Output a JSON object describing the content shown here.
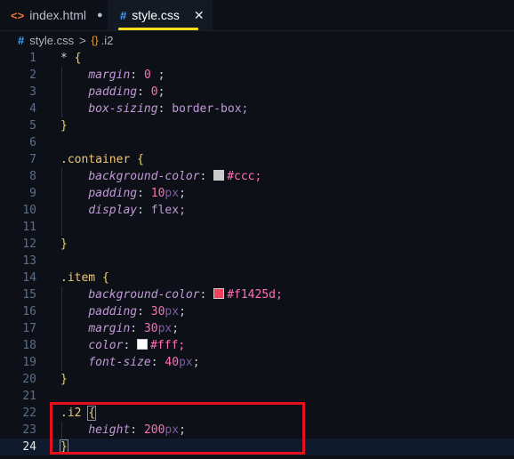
{
  "tabs": [
    {
      "label": "index.html",
      "icon": "html-icon",
      "icon_glyph": "<>",
      "modified_dot": "●"
    },
    {
      "label": "style.css",
      "icon": "css-icon",
      "icon_glyph": "#",
      "close": "✕"
    }
  ],
  "breadcrumb": {
    "file": "style.css",
    "separator": ">",
    "symbol": ".i2",
    "symbol_glyph": "{}"
  },
  "colors": {
    "accent_tab_underline": "#f7df1e",
    "highlight_box": "#e8101f",
    "swatch_ccc": "#cccccc",
    "swatch_f1425d": "#f1425d",
    "swatch_fff": "#ffffff"
  },
  "lines": [
    {
      "n": "1",
      "t": [
        "* ",
        "{"
      ]
    },
    {
      "n": "2",
      "p": "margin",
      "v": "0 ;"
    },
    {
      "n": "3",
      "p": "padding",
      "v": "0;"
    },
    {
      "n": "4",
      "p": "box-sizing",
      "v": "border-box;"
    },
    {
      "n": "5",
      "t": [
        "",
        "}"
      ]
    },
    {
      "n": "6"
    },
    {
      "n": "7",
      "t": [
        ".container ",
        "{"
      ]
    },
    {
      "n": "8",
      "p": "background-color",
      "v": "#ccc;"
    },
    {
      "n": "9",
      "p": "padding",
      "v": "10px;"
    },
    {
      "n": "10",
      "p": "display",
      "v": "flex;"
    },
    {
      "n": "11"
    },
    {
      "n": "12",
      "t": [
        "",
        "}"
      ]
    },
    {
      "n": "13"
    },
    {
      "n": "14",
      "t": [
        ".item ",
        "{"
      ]
    },
    {
      "n": "15",
      "p": "background-color",
      "v": "#f1425d;"
    },
    {
      "n": "16",
      "p": "padding",
      "v": "30px;"
    },
    {
      "n": "17",
      "p": "margin",
      "v": "30px;"
    },
    {
      "n": "18",
      "p": "color",
      "v": "#fff;"
    },
    {
      "n": "19",
      "p": "font-size",
      "v": "40px;"
    },
    {
      "n": "20",
      "t": [
        "",
        "}"
      ]
    },
    {
      "n": "21"
    },
    {
      "n": "22",
      "t": [
        ".i2 ",
        "{"
      ]
    },
    {
      "n": "23",
      "p": "height",
      "v": "200px;"
    },
    {
      "n": "24",
      "t": [
        "",
        "}"
      ]
    }
  ]
}
